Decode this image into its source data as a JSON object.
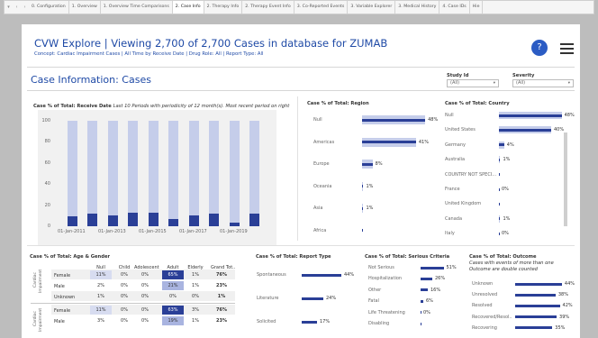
{
  "tabbar": {
    "tabs": [
      "0. Configuration",
      "1. Overview",
      "1. Overview Time Comparisons",
      "2. Case Info",
      "2. Therapy Info",
      "2. Therapy Event Info",
      "3. Co-Reported Events",
      "3. Variable Explorer",
      "3. Medical History",
      "4. Case IDs",
      "Hie"
    ],
    "active_index": 3
  },
  "header": {
    "title": "CVW Explore | Viewing 2,700 of 2,700 Cases in database for ZUMAB",
    "subtitle": "Concept: Cardiac Impairment Cases  |  All Time by Receive Date  |  Drug Role: All  |  Report Type: All",
    "help_label": "?"
  },
  "section": {
    "title": "Case Information: Cases"
  },
  "filters": {
    "study": {
      "label": "Study Id",
      "value": "(All)"
    },
    "severity": {
      "label": "Severity",
      "value": "(All)"
    }
  },
  "colors": {
    "light": "#c5cdea",
    "dark": "#2a3f97",
    "accent": "#1f4aa6"
  },
  "charts": {
    "receive": {
      "title": "Case % of Total: Receive Date",
      "note": "Last 10 Periods with periodicity of 12 month(s). Most recent period on right"
    },
    "region": {
      "title": "Case % of Total: Region"
    },
    "country": {
      "title": "Case % of Total: Country"
    },
    "age": {
      "title": "Case % of Total: Age & Gender"
    },
    "report": {
      "title": "Case % of Total: Report Type"
    },
    "serious": {
      "title": "Case % of Total: Serious Criteria"
    },
    "outcome": {
      "title": "Case % of Total: Outcome",
      "note1": "Cases with events of more than one",
      "note2": "Outcome are double counted"
    }
  },
  "chart_data": [
    {
      "type": "bar",
      "title": "Case % of Total: Receive Date",
      "categories": [
        "01-Jan-2011",
        "",
        "01-Jan-2013",
        "",
        "01-Jan-2015",
        "",
        "01-Jan-2017",
        "",
        "01-Jan-2019",
        ""
      ],
      "series": [
        {
          "values": [
            9,
            12,
            10,
            13,
            13,
            7,
            10,
            12,
            3,
            12
          ]
        }
      ],
      "background_values": [
        100,
        100,
        100,
        100,
        100,
        100,
        100,
        100,
        100,
        100
      ],
      "yticks": [
        "100",
        "80",
        "60",
        "40",
        "20",
        "0"
      ],
      "ylim": [
        0,
        100
      ]
    },
    {
      "type": "bar",
      "title": "Case % of Total: Region",
      "categories": [
        "Null",
        "Americas",
        "Europe",
        "Oceania",
        "Asia",
        "Africa"
      ],
      "values": [
        48,
        41,
        8,
        1,
        1,
        0
      ],
      "labels": [
        "48%",
        "41%",
        "8%",
        "1%",
        "1%",
        ""
      ]
    },
    {
      "type": "bar",
      "title": "Case % of Total: Country",
      "categories": [
        "Null",
        "United States",
        "Germany",
        "Australia",
        "COUNTRY NOT SPECI...",
        "France",
        "United Kingdom",
        "Canada",
        "Italy"
      ],
      "values": [
        48,
        40,
        4,
        1,
        0,
        0,
        0,
        1,
        0
      ],
      "labels": [
        "48%",
        "40%",
        "4%",
        "1%",
        "",
        "0%",
        "",
        "1%",
        "0%"
      ]
    },
    {
      "type": "table",
      "title": "Case % of Total: Age & Gender",
      "columns": [
        "Null",
        "Child",
        "Adolescent",
        "Adult",
        "Elderly",
        "Grand Tot.."
      ],
      "groups": [
        "Cardiac Impairment",
        "Cardiac Impairment"
      ],
      "rows": [
        {
          "label": "Female",
          "values": [
            "11%",
            "0%",
            "0%",
            "65%",
            "1%",
            "76%"
          ]
        },
        {
          "label": "Male",
          "values": [
            "2%",
            "0%",
            "0%",
            "21%",
            "1%",
            "23%"
          ]
        },
        {
          "label": "Unknown",
          "values": [
            "1%",
            "0%",
            "0%",
            "0%",
            "0%",
            "1%"
          ]
        },
        {
          "label": "Female",
          "values": [
            "11%",
            "0%",
            "0%",
            "63%",
            "3%",
            "76%"
          ]
        },
        {
          "label": "Male",
          "values": [
            "3%",
            "0%",
            "0%",
            "19%",
            "1%",
            "23%"
          ]
        }
      ]
    },
    {
      "type": "bar",
      "title": "Case % of Total: Report Type",
      "categories": [
        "Spontaneous",
        "Literature",
        "Solicited"
      ],
      "values": [
        44,
        24,
        17
      ],
      "labels": [
        "44%",
        "24%",
        "17%"
      ]
    },
    {
      "type": "bar",
      "title": "Case % of Total: Serious Criteria",
      "categories": [
        "Not Serious",
        "Hospitalization",
        "Other",
        "Fatal",
        "Life Threatening",
        "Disabling"
      ],
      "values": [
        51,
        26,
        16,
        6,
        0,
        0
      ],
      "labels": [
        "51%",
        "26%",
        "16%",
        "6%",
        "0%",
        ""
      ]
    },
    {
      "type": "bar",
      "title": "Case % of Total: Outcome",
      "categories": [
        "Unknown",
        "Unresolved",
        "Resolved",
        "Recovered/Resol..",
        "Recovering"
      ],
      "values": [
        44,
        38,
        42,
        39,
        35
      ],
      "labels": [
        "44%",
        "38%",
        "42%",
        "39%",
        "35%"
      ]
    }
  ]
}
